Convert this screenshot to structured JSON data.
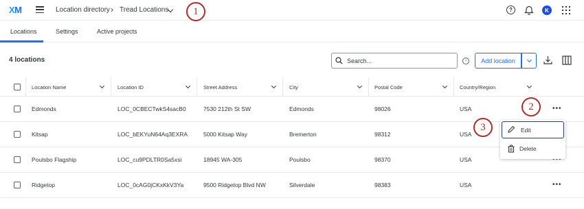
{
  "header": {
    "logo_x": "X",
    "logo_m": "M",
    "breadcrumb_1": "Location directory",
    "breadcrumb_sep": "›",
    "breadcrumb_2": "Tread Locations",
    "help_icon": "help-circle-icon",
    "bell_icon": "bell-icon",
    "avatar_initial": "K",
    "apps_icon": "apps-grid-icon"
  },
  "tabs": [
    {
      "label": "Locations",
      "active": true
    },
    {
      "label": "Settings",
      "active": false
    },
    {
      "label": "Active projects",
      "active": false
    }
  ],
  "toolbar": {
    "count": "4 locations",
    "search_placeholder": "Search...",
    "add_label": "Add location"
  },
  "table": {
    "columns": [
      "Location Name",
      "Location ID",
      "Street Address",
      "City",
      "Postal Code",
      "Country/Region"
    ],
    "rows": [
      [
        "Edmonds",
        "LOC_0CBECTwkS4sacB0",
        "7530 212th St SW",
        "Edmonds",
        "98026",
        "USA"
      ],
      [
        "Kitsap",
        "LOC_bEKYuN64Aq3EXRA",
        "5000 Kitsap Way",
        "Bremerton",
        "98312",
        "USA"
      ],
      [
        "Poulsbo Flagship",
        "LOC_cu9PDLTR0Sa5xsi",
        "18945 WA-305",
        "Poulsbo",
        "98370",
        "USA"
      ],
      [
        "Ridgetop",
        "LOC_0cAG0jCKxKkV3Ya",
        "9500 Ridgetop Blvd NW",
        "Silverdale",
        "98383",
        "USA"
      ]
    ]
  },
  "context_menu": {
    "edit_label": "Edit",
    "delete_label": "Delete"
  },
  "callouts": [
    "1",
    "2",
    "3"
  ],
  "colors": {
    "accent": "#1d6ff2",
    "callout": "#b12a2a",
    "avatar": "#1d4fd8"
  }
}
